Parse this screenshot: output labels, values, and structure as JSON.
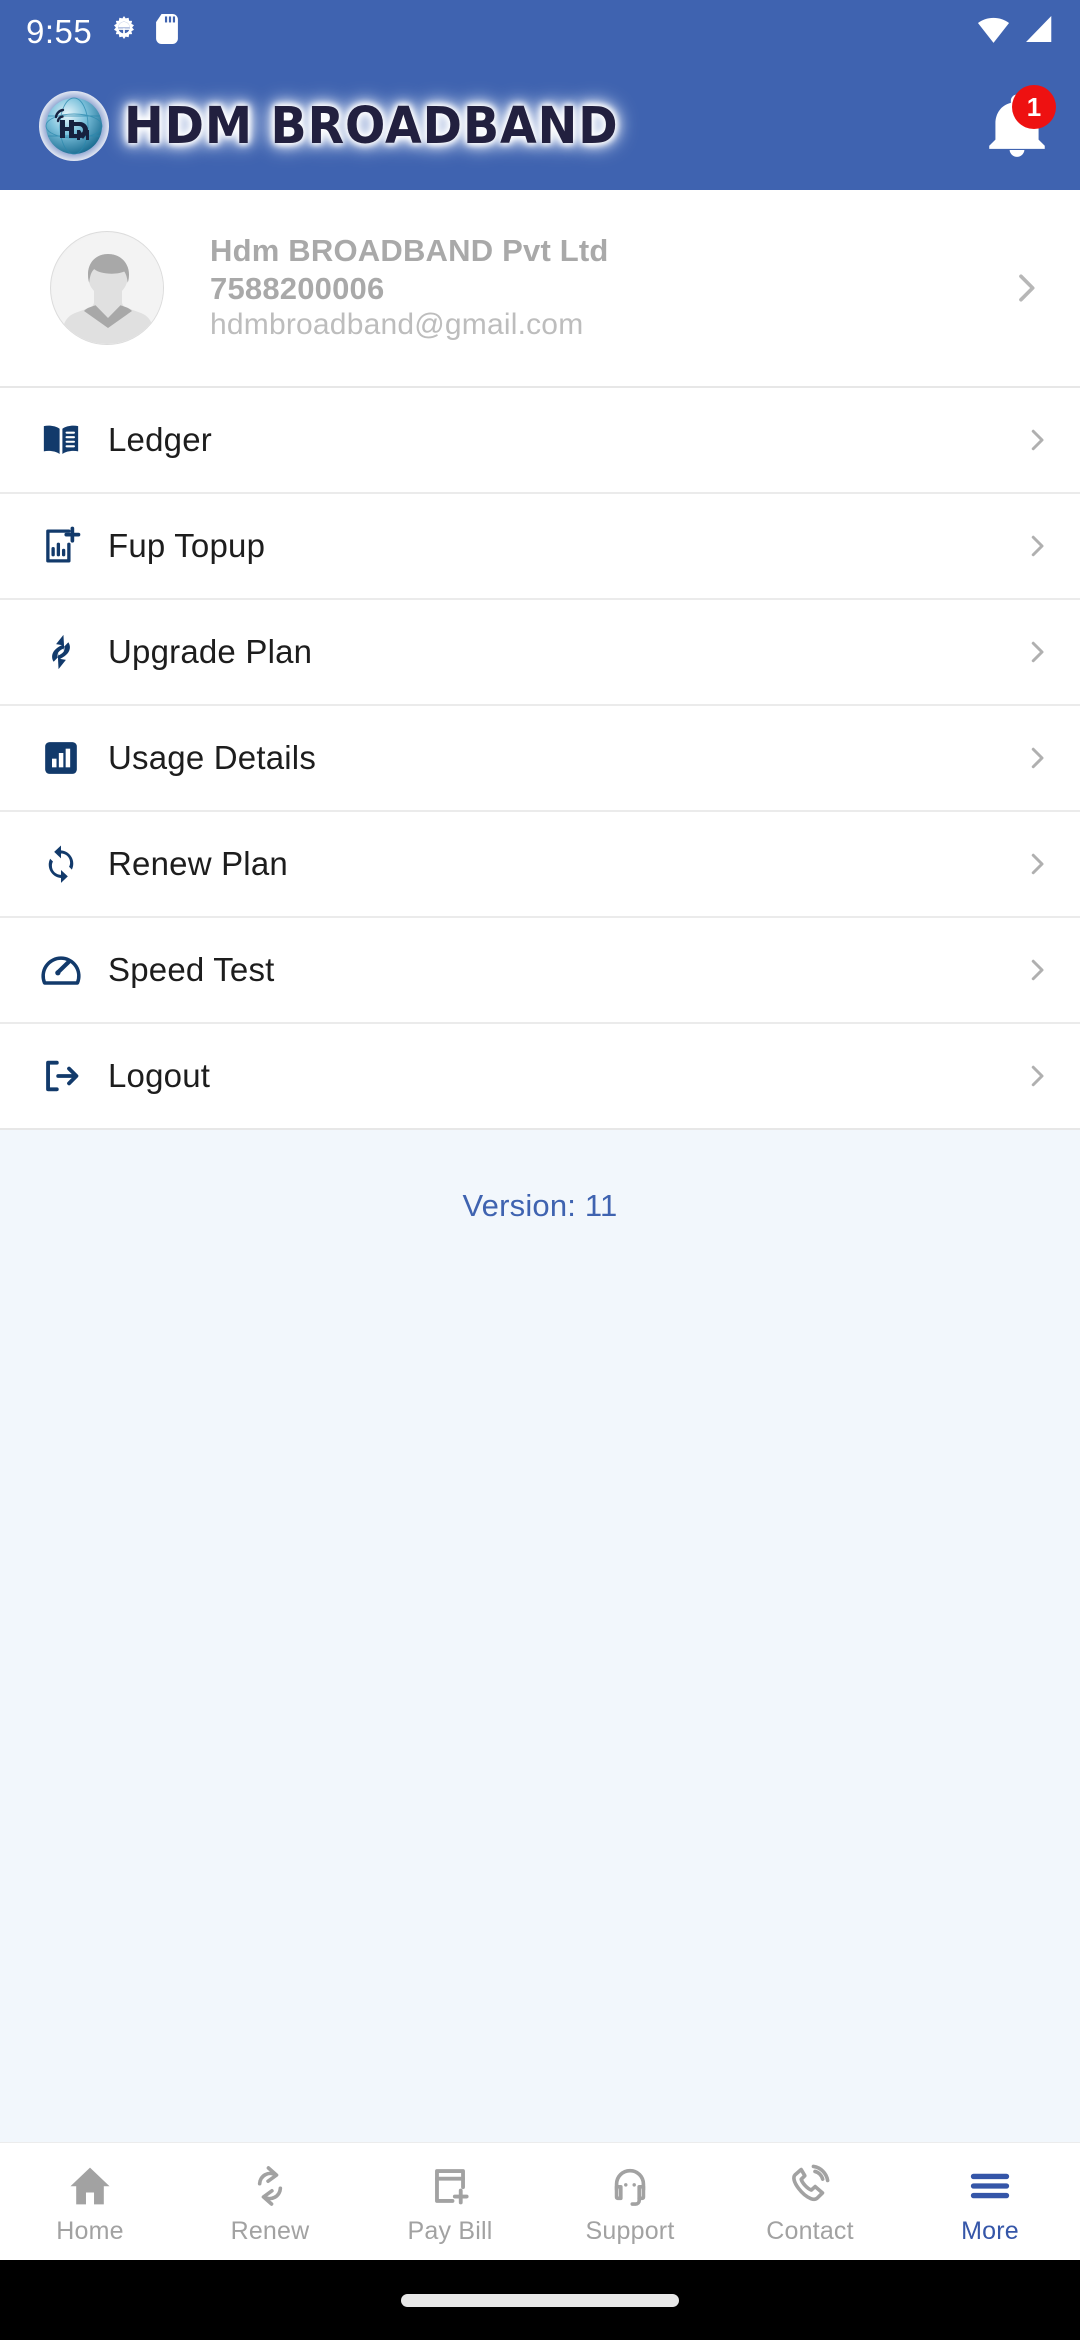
{
  "status_bar": {
    "time": "9:55",
    "icons_left": [
      "android-debug-icon",
      "sd-card-icon"
    ],
    "icons_right": [
      "wifi-icon",
      "cellular-signal-icon"
    ]
  },
  "app_bar": {
    "brand_title": "HDM BROADBAND",
    "logo_icon": "hdm-globe-logo-icon",
    "notification_icon": "bell-icon",
    "notification_badge": "1",
    "background_color": "#3f63b0",
    "title_color": "#22203f"
  },
  "profile": {
    "avatar_icon": "avatar-placeholder-icon",
    "name": "Hdm BROADBAND Pvt Ltd",
    "phone": "7588200006",
    "email": "hdmbroadband@gmail.com",
    "chevron_icon": "chevron-right-icon"
  },
  "menu": {
    "items": [
      {
        "label": "Ledger",
        "icon": "book-icon"
      },
      {
        "label": "Fup Topup",
        "icon": "chart-add-icon"
      },
      {
        "label": "Upgrade Plan",
        "icon": "swap-arrows-icon"
      },
      {
        "label": "Usage Details",
        "icon": "bar-chart-icon"
      },
      {
        "label": "Renew Plan",
        "icon": "refresh-icon"
      },
      {
        "label": "Speed Test",
        "icon": "speedometer-icon"
      },
      {
        "label": "Logout",
        "icon": "logout-icon"
      }
    ],
    "chevron_icon": "chevron-right-icon",
    "icon_color": "#123a6b"
  },
  "version_text": "Version: 11",
  "bottom_nav": {
    "active_color": "#3556a8",
    "inactive_color": "#a2a2a2",
    "items": [
      {
        "label": "Home",
        "icon": "home-icon",
        "active": false
      },
      {
        "label": "Renew",
        "icon": "refresh-icon",
        "active": false
      },
      {
        "label": "Pay Bill",
        "icon": "card-add-icon",
        "active": false
      },
      {
        "label": "Support",
        "icon": "headset-icon",
        "active": false
      },
      {
        "label": "Contact",
        "icon": "phone-call-icon",
        "active": false
      },
      {
        "label": "More",
        "icon": "hamburger-icon",
        "active": true
      }
    ]
  },
  "gesture_bar": {
    "pill_icon": "gesture-pill"
  }
}
